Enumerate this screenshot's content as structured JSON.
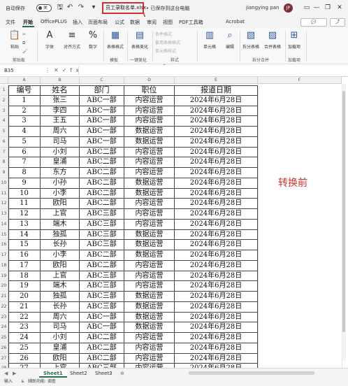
{
  "titlebar": {
    "autosave_label": "自动保存",
    "autosave_state": "关",
    "filename": "员工录取名单.xlsx",
    "saved_status": "• 已保存到这台电脑",
    "username": "jiangying pan",
    "avatar_initials": "JP"
  },
  "tabs": [
    "文件",
    "开始",
    "OfficePLUS",
    "插入",
    "页面布局",
    "公式",
    "数据",
    "审阅",
    "视图",
    "PDF工具箱",
    "Acrobat"
  ],
  "active_tab": "开始",
  "ribbon": {
    "paste": "粘贴",
    "font": "字体",
    "align": "对齐方式",
    "number": "数字",
    "table_style": "表格格式",
    "beautify": "表格美化",
    "cond_format": "条件格式",
    "apply_table": "套用表格格式",
    "cell_style": "单元格样式",
    "cells": "单元格",
    "edit": "编辑",
    "split": "拆分表格",
    "merge": "合并表格",
    "addin": "加载项",
    "groups": {
      "clipboard": "剪贴板",
      "template": "模板",
      "beautify": "一键美化",
      "style": "样式",
      "split_merge": "拆分合并",
      "addins": "加载项"
    }
  },
  "formula_bar": {
    "name_box": "B35",
    "formula": ""
  },
  "columns": [
    "A",
    "B",
    "C",
    "D",
    "E",
    "F"
  ],
  "table": {
    "headers": [
      "编号",
      "姓名",
      "部门",
      "职位",
      "报道日期"
    ],
    "rows": [
      [
        "1",
        "张三",
        "ABC一部",
        "内容运营",
        "2024年6月28日"
      ],
      [
        "2",
        "李四",
        "ABC一部",
        "内容运营",
        "2024年6月28日"
      ],
      [
        "3",
        "王五",
        "ABC一部",
        "内容运营",
        "2024年6月28日"
      ],
      [
        "4",
        "周六",
        "ABC一部",
        "数据运营",
        "2024年6月28日"
      ],
      [
        "5",
        "司马",
        "ABC一部",
        "数据运营",
        "2024年6月28日"
      ],
      [
        "6",
        "小刘",
        "ABC二部",
        "内容运营",
        "2024年6月28日"
      ],
      [
        "7",
        "皇浦",
        "ABC二部",
        "内容运营",
        "2024年6月28日"
      ],
      [
        "8",
        "东方",
        "ABC二部",
        "内容运营",
        "2024年6月28日"
      ],
      [
        "9",
        "小孙",
        "ABC二部",
        "数据运营",
        "2024年6月28日"
      ],
      [
        "10",
        "小李",
        "ABC二部",
        "数据运营",
        "2024年6月28日"
      ],
      [
        "11",
        "欧阳",
        "ABC二部",
        "内容运营",
        "2024年6月28日"
      ],
      [
        "12",
        "上官",
        "ABC三部",
        "内容运营",
        "2024年6月28日"
      ],
      [
        "13",
        "端木",
        "ABC三部",
        "内容运营",
        "2024年6月28日"
      ],
      [
        "14",
        "独孤",
        "ABC三部",
        "数据运营",
        "2024年6月28日"
      ],
      [
        "15",
        "长孙",
        "ABC三部",
        "数据运营",
        "2024年6月28日"
      ],
      [
        "16",
        "小李",
        "ABC二部",
        "数据运营",
        "2024年6月28日"
      ],
      [
        "17",
        "欧阳",
        "ABC二部",
        "内容运营",
        "2024年6月28日"
      ],
      [
        "18",
        "上官",
        "ABC三部",
        "内容运营",
        "2024年6月28日"
      ],
      [
        "19",
        "端木",
        "ABC三部",
        "内容运营",
        "2024年6月28日"
      ],
      [
        "20",
        "独孤",
        "ABC三部",
        "数据运营",
        "2024年6月28日"
      ],
      [
        "21",
        "长孙",
        "ABC三部",
        "数据运营",
        "2024年6月28日"
      ],
      [
        "22",
        "周六",
        "ABC一部",
        "数据运营",
        "2024年6月28日"
      ],
      [
        "23",
        "司马",
        "ABC一部",
        "数据运营",
        "2024年6月28日"
      ],
      [
        "24",
        "小刘",
        "ABC二部",
        "内容运营",
        "2024年6月28日"
      ],
      [
        "25",
        "皇浦",
        "ABC二部",
        "内容运营",
        "2024年6月28日"
      ],
      [
        "26",
        "欧阳",
        "ABC二部",
        "内容运营",
        "2024年6月28日"
      ],
      [
        "27",
        "上官",
        "ABC三部",
        "内容运营",
        "2024年6月28日"
      ]
    ]
  },
  "annotation_text": "转换前",
  "sheets": [
    "Sheet1",
    "Sheet2",
    "Sheet3"
  ],
  "active_sheet": "Sheet1",
  "status": {
    "mode": "输入",
    "accessibility": "辅助功能: 调查"
  },
  "colors": {
    "accent": "#217346",
    "annotation": "#d62f2f"
  }
}
